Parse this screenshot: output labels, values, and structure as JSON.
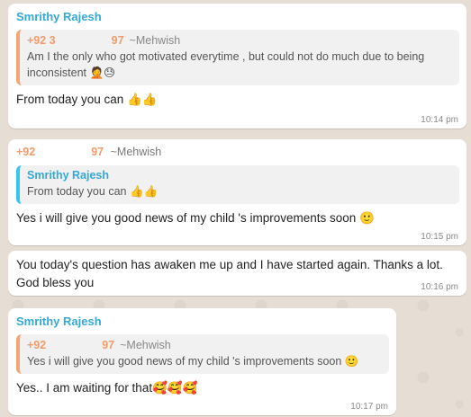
{
  "messages": [
    {
      "sender": "Smrithy Rajesh",
      "quote": {
        "phone_start": "+92 3",
        "phone_end": "97",
        "name": "~Mehwish",
        "text": "Am I the only who  got motivated everytime , but could not do much due to being inconsistent 🤦😓"
      },
      "text": "From today you can 👍👍",
      "time": "10:14 pm"
    },
    {
      "header_phone_start": "+92",
      "header_phone_end": "97",
      "header_name": "~Mehwish",
      "quote": {
        "sender": "Smrithy Rajesh",
        "text": "From today you can 👍👍"
      },
      "text": "Yes i will give you good news of my child 's improvements soon 🙂",
      "time": "10:15 pm"
    },
    {
      "text": "You today's question has awaken me up and I have started again. Thanks a lot. God bless you",
      "time": "10:16 pm"
    },
    {
      "sender": "Smrithy Rajesh",
      "quote": {
        "phone_start": "+92",
        "phone_end": "97",
        "name": "~Mehwish",
        "text": "Yes i will give you good news of my child 's improvements soon 🙂"
      },
      "text": "Yes.. I am waiting for that🥰🥰🥰",
      "time": "10:17 pm"
    }
  ]
}
